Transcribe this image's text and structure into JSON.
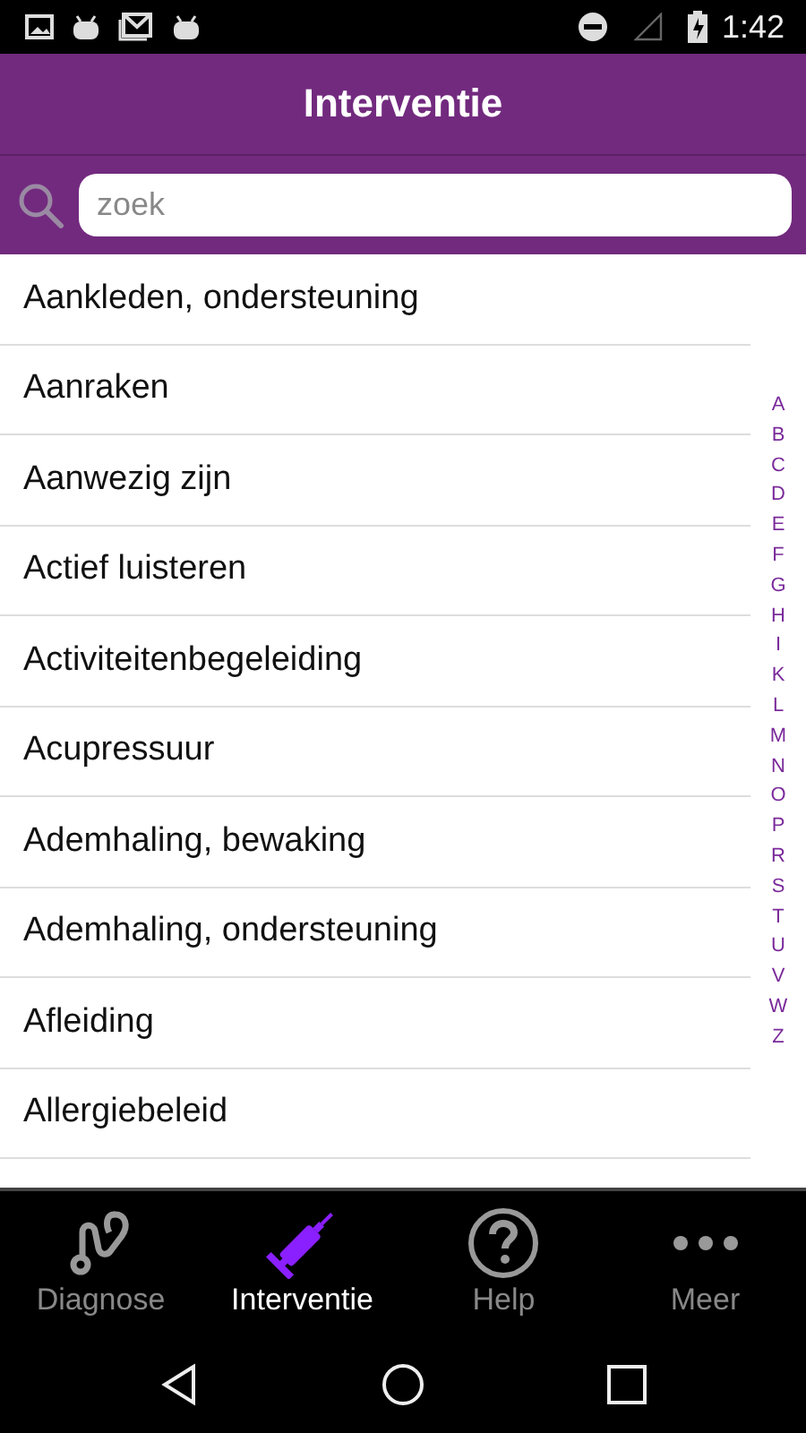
{
  "status_bar": {
    "time": "1:42"
  },
  "header": {
    "title": "Interventie"
  },
  "search": {
    "placeholder": "zoek"
  },
  "items": [
    "Aankleden, ondersteuning",
    "Aanraken",
    "Aanwezig zijn",
    "Actief luisteren",
    "Activiteitenbegeleiding",
    "Acupressuur",
    "Ademhaling, bewaking",
    "Ademhaling, ondersteuning",
    "Afleiding",
    "Allergiebeleid"
  ],
  "index": [
    "A",
    "B",
    "C",
    "D",
    "E",
    "F",
    "G",
    "H",
    "I",
    "K",
    "L",
    "M",
    "N",
    "O",
    "P",
    "R",
    "S",
    "T",
    "U",
    "V",
    "W",
    "Z"
  ],
  "tabs": [
    {
      "label": "Diagnose",
      "kind": "stethoscope",
      "selected": false
    },
    {
      "label": "Interventie",
      "kind": "syringe",
      "selected": true
    },
    {
      "label": "Help",
      "kind": "help",
      "selected": false
    },
    {
      "label": "Meer",
      "kind": "more",
      "selected": false
    }
  ]
}
